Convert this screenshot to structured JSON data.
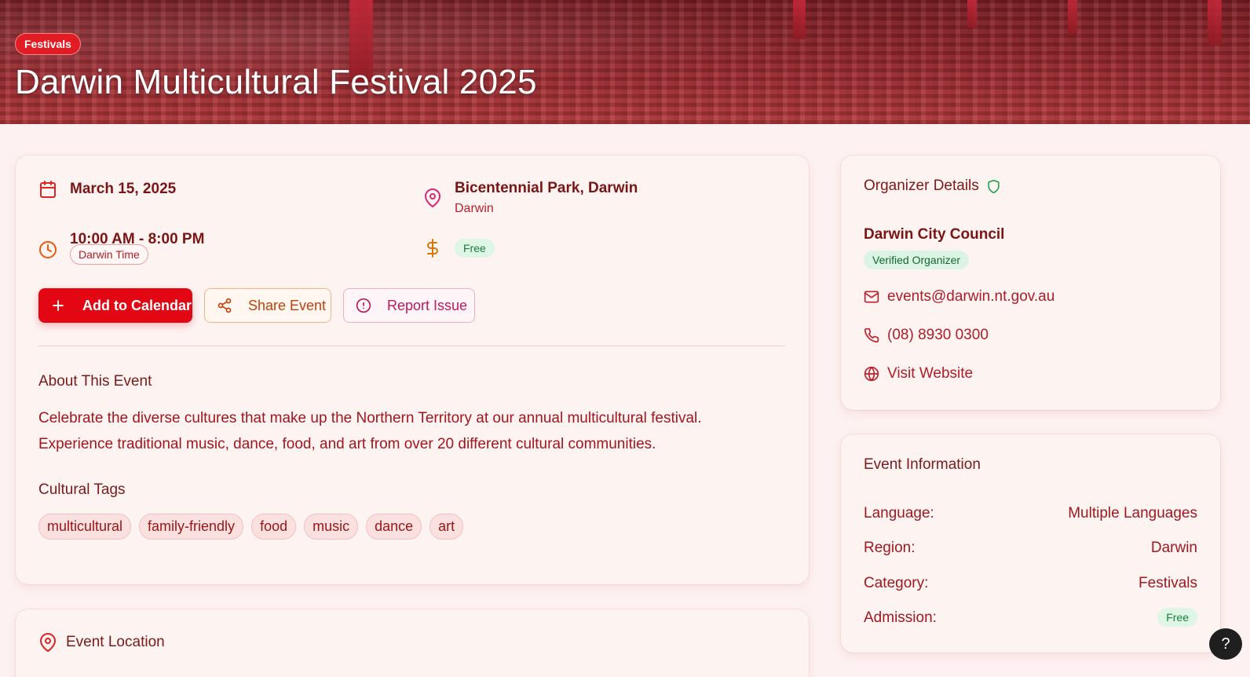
{
  "hero": {
    "category_badge": "Festivals",
    "title": "Darwin Multicultural Festival 2025"
  },
  "details": {
    "date": "March 15, 2025",
    "time": "10:00 AM - 8:00 PM",
    "timezone": "Darwin Time",
    "venue": "Bicentennial Park, Darwin",
    "city": "Darwin",
    "price": "Free"
  },
  "actions": {
    "add_calendar": "Add to Calendar",
    "share": "Share Event",
    "report": "Report Issue"
  },
  "about": {
    "heading": "About This Event",
    "body": "Celebrate the diverse cultures that make up the Northern Territory at our annual multicultural festival. Experience traditional music, dance, food, and art from over 20 different cultural communities."
  },
  "cultural_tags": {
    "heading": "Cultural Tags",
    "tags": [
      "multicultural",
      "family-friendly",
      "food",
      "music",
      "dance",
      "art"
    ]
  },
  "location_section": {
    "heading": "Event Location"
  },
  "organizer": {
    "heading": "Organizer Details",
    "name": "Darwin City Council",
    "verified_label": "Verified Organizer",
    "email": "events@darwin.nt.gov.au",
    "phone": "(08) 8930 0300",
    "website_label": "Visit Website"
  },
  "event_info": {
    "heading": "Event Information",
    "rows": [
      {
        "label": "Language:",
        "value": "Multiple Languages"
      },
      {
        "label": "Region:",
        "value": "Darwin"
      },
      {
        "label": "Category:",
        "value": "Festivals"
      },
      {
        "label": "Admission:",
        "value": "Free"
      }
    ]
  },
  "help": {
    "label": "?"
  },
  "colors": {
    "primary": "#e30613",
    "text_dark": "#7a1515",
    "accent_green": "#15803d",
    "page_bg": "#fdf1f1"
  },
  "icons": {
    "date": "calendar-icon",
    "time": "clock-icon",
    "venue": "map-pin-icon",
    "price": "dollar-icon",
    "verified": "shield-icon",
    "email": "mail-icon",
    "phone": "phone-icon",
    "website": "globe-icon"
  }
}
